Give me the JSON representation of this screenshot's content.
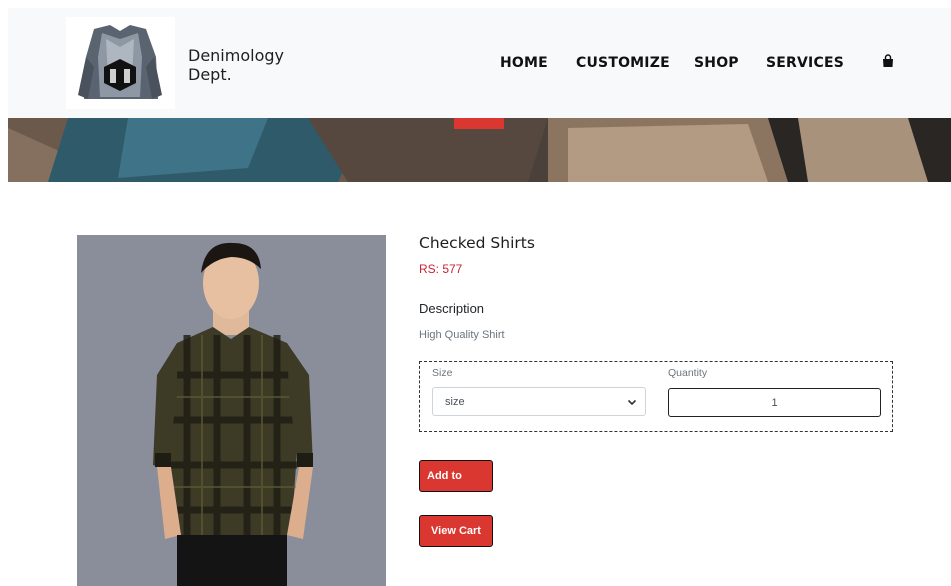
{
  "brand": {
    "line1": "Denimology",
    "line2": "Dept."
  },
  "nav": {
    "home": "HOME",
    "customize": "CUSTOMIZE",
    "shop": "SHOP",
    "services": "SERVICES",
    "cart_icon": "shopping-bag-icon"
  },
  "product": {
    "title": "Checked Shirts",
    "price": "RS: 577",
    "description_heading": "Description",
    "description": "High Quality Shirt"
  },
  "options": {
    "size_label": "Size",
    "size_selected": "size",
    "quantity_label": "Quantity",
    "quantity_value": "1"
  },
  "buttons": {
    "add_to_cart": "Add to Cart",
    "view_cart": "View Cart"
  },
  "colors": {
    "accent": "#d9372f",
    "price": "#c82333",
    "header_bg": "#f8f9fa"
  }
}
